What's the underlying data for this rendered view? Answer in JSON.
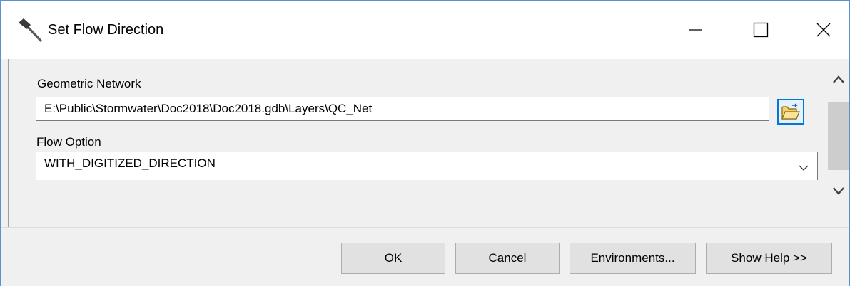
{
  "window": {
    "title": "Set Flow Direction",
    "icon": "hammer-icon",
    "controls": [
      "minimize-icon",
      "maximize-icon",
      "close-icon"
    ]
  },
  "geometric_network": {
    "label": "Geometric Network",
    "value": "E:\\Public\\Stormwater\\Doc2018\\Doc2018.gdb\\Layers\\QC_Net",
    "browse_icon": "open-folder-icon"
  },
  "flow_option": {
    "label": "Flow Option",
    "value": "WITH_DIGITIZED_DIRECTION",
    "icon": "chevron-down-icon"
  },
  "buttons": {
    "ok": "OK",
    "cancel": "Cancel",
    "environments": "Environments...",
    "show_help": "Show Help >>"
  },
  "colors": {
    "accent": "#0078d7",
    "window_border": "#5b8fd6",
    "dialog_background": "#f0f0f0"
  }
}
